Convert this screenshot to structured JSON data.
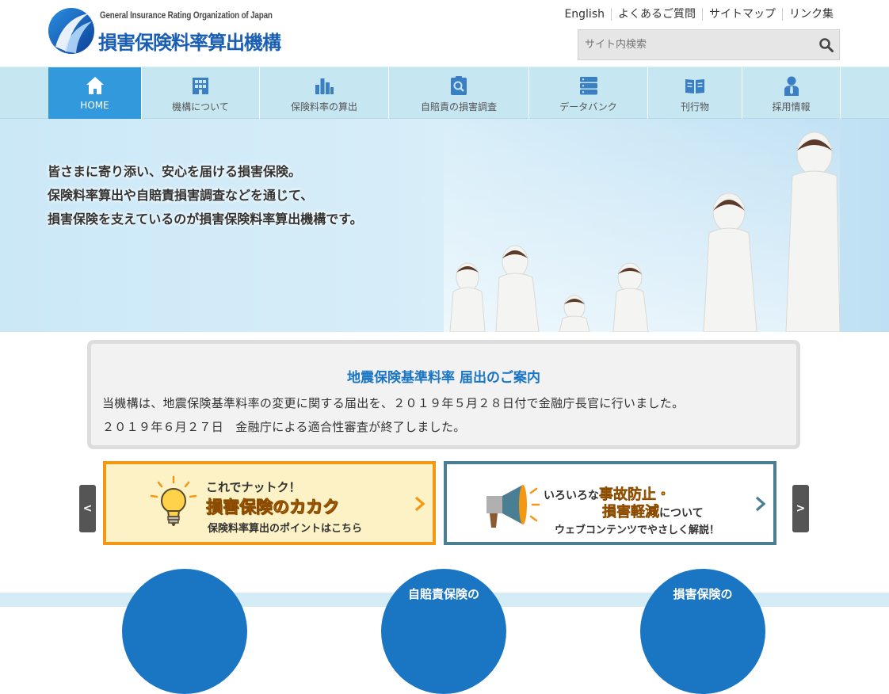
{
  "header": {
    "logo_en": "General Insurance Rating Organization of Japan",
    "logo_jp": "損害保険料率算出機構",
    "util_links": [
      "English",
      "よくあるご質問",
      "サイトマップ",
      "リンク集"
    ],
    "search_placeholder": "サイト内検索"
  },
  "nav": {
    "items": [
      {
        "label": "HOME",
        "icon": "home-icon"
      },
      {
        "label": "機構について",
        "icon": "building-icon"
      },
      {
        "label": "保険料率の算出",
        "icon": "bar-chart-icon"
      },
      {
        "label": "自賠責の損害調査",
        "icon": "clipboard-search-icon"
      },
      {
        "label": "データバンク",
        "icon": "database-icon"
      },
      {
        "label": "刊行物",
        "icon": "book-icon"
      },
      {
        "label": "採用情報",
        "icon": "person-icon"
      }
    ]
  },
  "hero": {
    "lines": [
      "皆さまに寄り添い、安心を届ける損害保険。",
      "保険料率算出や自賠責損害調査などを通じて、",
      "損害保険を支えているのが損害保険料率算出機構です。"
    ]
  },
  "notice": {
    "title": "地震保険基準料率 届出のご案内",
    "line1": "当機構は、地震保険基準料率の変更に関する届出を、２０１９年５月２８日付で金融庁長官に行いました。",
    "line2": "２０１９年６月２７日　金融庁による適合性審査が終了しました。"
  },
  "carousel": {
    "prev": "<",
    "next": ">",
    "banner1": {
      "line1": "これでナットク！",
      "line2": "損害保険のカカク",
      "line3": "保険料率算出のポイントはこちら"
    },
    "banner2": {
      "line1_pre": "いろいろな",
      "line1_em": "事故防止・",
      "line2_em": "損害軽減",
      "line2_post": "について",
      "line3": "ウェブコンテンツでやさしく解説！"
    }
  },
  "circles": [
    {
      "line1": "",
      "line2": ""
    },
    {
      "line1": "自賠責保険の",
      "line2": ""
    },
    {
      "line1": "損害保険の",
      "line2": ""
    }
  ],
  "colors": {
    "brand_blue": "#1a75c2",
    "nav_bg": "#c6e6f2",
    "nav_active": "#3399dd",
    "orange": "#f39812",
    "teal": "#4a7e92"
  }
}
